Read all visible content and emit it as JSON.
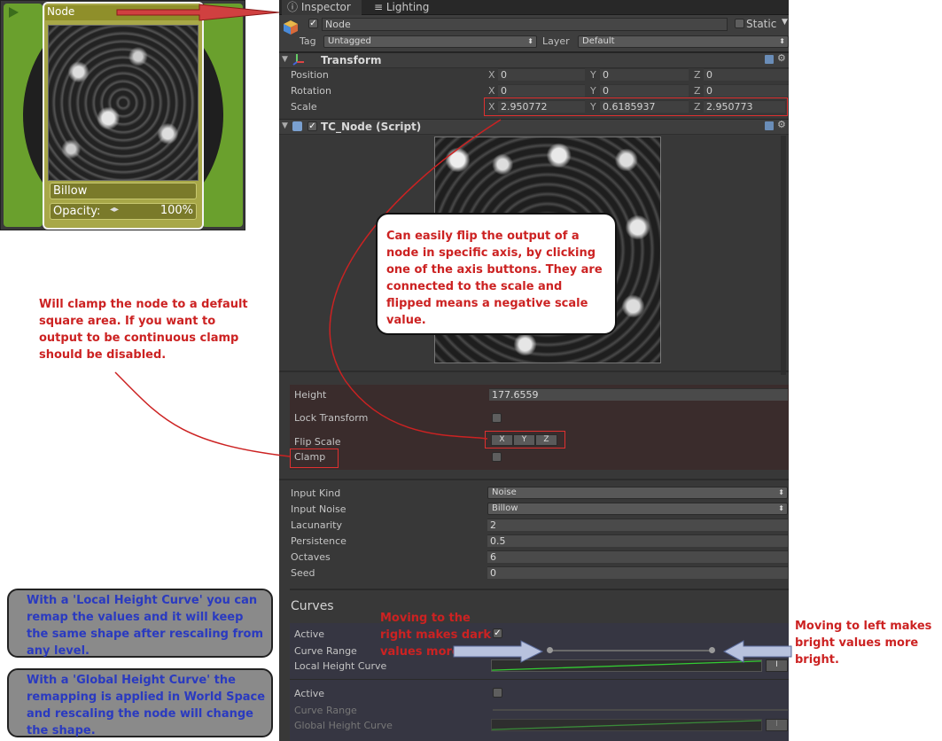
{
  "node_card": {
    "title": "Node",
    "noise_label": "Billow",
    "opacity_label": "Opacity:",
    "opacity_arrows": "◂▸",
    "opacity_value": "100%"
  },
  "tabs": {
    "inspector": "Inspector",
    "lighting": "Lighting"
  },
  "gameobject": {
    "name": "Node",
    "static_label": "Static",
    "tag_label": "Tag",
    "tag_value": "Untagged",
    "layer_label": "Layer",
    "layer_value": "Default"
  },
  "transform": {
    "title": "Transform",
    "rows": [
      {
        "label": "Position",
        "x": "0",
        "y": "0",
        "z": "0"
      },
      {
        "label": "Rotation",
        "x": "0",
        "y": "0",
        "z": "0"
      },
      {
        "label": "Scale",
        "x": "2.950772",
        "y": "0.6185937",
        "z": "2.950773"
      }
    ],
    "axis_x": "X",
    "axis_y": "Y",
    "axis_z": "Z"
  },
  "script": {
    "title": "TC_Node (Script)",
    "height_label": "Height",
    "height_value": "177.6559",
    "lock_transform_label": "Lock Transform",
    "flip_scale_label": "Flip Scale",
    "flip_x": "X",
    "flip_y": "Y",
    "flip_z": "Z",
    "clamp_label": "Clamp",
    "input_kind_label": "Input Kind",
    "input_kind_value": "Noise",
    "input_noise_label": "Input Noise",
    "input_noise_value": "Billow",
    "lacunarity_label": "Lacunarity",
    "lacunarity_value": "2",
    "persistence_label": "Persistence",
    "persistence_value": "0.5",
    "octaves_label": "Octaves",
    "octaves_value": "6",
    "seed_label": "Seed",
    "seed_value": "0"
  },
  "curves": {
    "title": "Curves",
    "active_label": "Active",
    "curve_range_label": "Curve Range",
    "local_curve_label": "Local Height Curve",
    "active2_label": "Active",
    "curve_range2_label": "Curve Range",
    "global_curve_label": "Global Height Curve",
    "button_i": "I"
  },
  "annotations": {
    "callout_flip": "Can easily flip the output of a node in specific axis, by clicking one of the axis buttons. They are connected to the scale and flipped means a negative scale value.",
    "clamp_note": "Will clamp the node to a default square area. If you want to output to be continuous clamp should be disabled.",
    "move_right_note": "Moving to the right makes dark values more dark",
    "move_left_note": "Moving to left makes bright values more bright.",
    "local_curve_note": "With a 'Local Height Curve' you can remap the values and it will keep the same shape after rescaling from any level.",
    "global_curve_note": "With a 'Global Height Curve' the remapping is applied in World Space and rescaling the node will change the shape."
  },
  "colors": {
    "annotation_red": "#cc2222",
    "annotation_blue": "#2a3ac0",
    "curve_green": "#33cc33"
  }
}
